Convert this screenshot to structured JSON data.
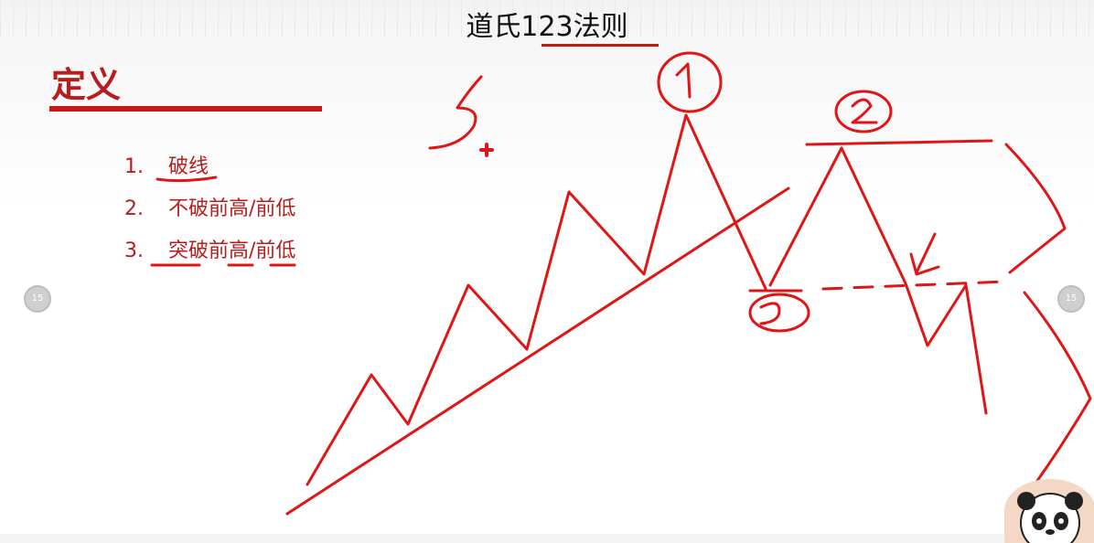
{
  "title": "道氏123法则",
  "heading": "定义",
  "definitions": [
    {
      "num": "1.",
      "text": "破线"
    },
    {
      "num": "2.",
      "text": "不破前高/前低"
    },
    {
      "num": "3.",
      "text": "突破前高/前低"
    }
  ],
  "nav": {
    "left_label": "15",
    "right_label": "15"
  },
  "colors": {
    "accent": "#c21a1a",
    "ink": "#e01616",
    "text": "#111111"
  }
}
